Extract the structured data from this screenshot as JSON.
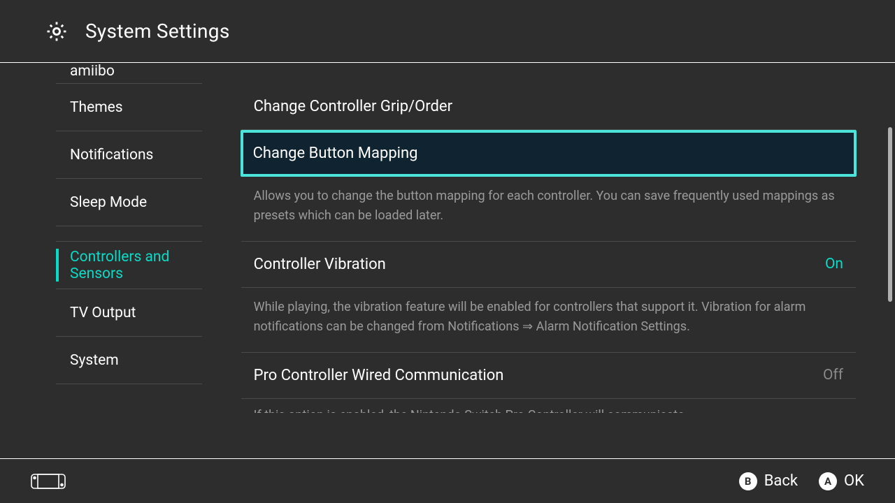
{
  "header": {
    "title": "System Settings"
  },
  "sidebar": {
    "partial_top": "amiibo",
    "items": [
      {
        "label": "Themes"
      },
      {
        "label": "Notifications"
      },
      {
        "label": "Sleep Mode"
      },
      {
        "label": "Controllers and Sensors",
        "active": true
      },
      {
        "label": "TV Output"
      },
      {
        "label": "System"
      }
    ]
  },
  "content": {
    "rows": [
      {
        "label": "Change Controller Grip/Order"
      },
      {
        "label": "Change Button Mapping",
        "selected": true,
        "desc": "Allows you to change the button mapping for each controller. You can save frequently used mappings as presets which can be loaded later."
      },
      {
        "label": "Controller Vibration",
        "value": "On",
        "value_state": "on",
        "desc": "While playing, the vibration feature will be enabled for controllers that support it. Vibration for alarm notifications can be changed from Notifications ⇒ Alarm Notification Settings."
      },
      {
        "label": "Pro Controller Wired Communication",
        "value": "Off",
        "value_state": "off",
        "desc_trunc": "If this option is enabled, the Nintendo Switch Pro Controller will communicate"
      }
    ]
  },
  "footer": {
    "hints": [
      {
        "glyph": "B",
        "label": "Back"
      },
      {
        "glyph": "A",
        "label": "OK"
      }
    ]
  }
}
